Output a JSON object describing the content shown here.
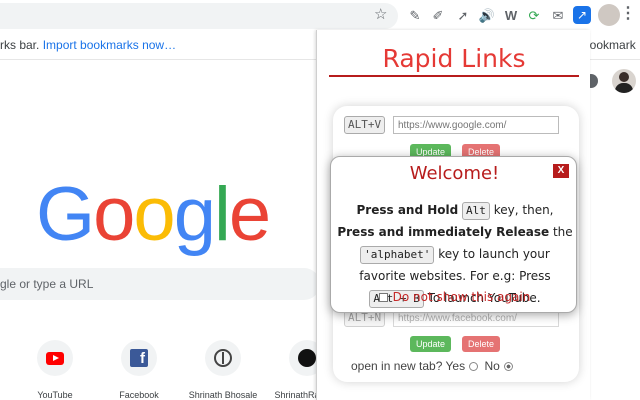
{
  "toolbar": {
    "icons": [
      "star-icon",
      "eyedropper-icon",
      "pen-icon",
      "arrow-icon",
      "speaker-icon",
      "w-icon",
      "refresh-icon",
      "mail-icon",
      "rapid-links-icon",
      "menu-icon"
    ],
    "accent": "#1a73e8"
  },
  "bookmarks_bar": {
    "left_text": "rks bar.",
    "import_link": "Import bookmarks now…",
    "right_text": "bookmark"
  },
  "google": {
    "logo_letters": [
      "G",
      "o",
      "o",
      "g",
      "l",
      "e"
    ],
    "logo_colors": [
      "#4285f4",
      "#ea4335",
      "#fbbc05",
      "#4285f4",
      "#34a853",
      "#ea4335"
    ],
    "search_placeholder": "gle or type a URL"
  },
  "shortcuts": [
    {
      "label": "YouTube",
      "icon": "youtube-icon"
    },
    {
      "label": "Facebook",
      "icon": "facebook-icon"
    },
    {
      "label": "Shrinath Bhosale",
      "icon": "brain-icon"
    },
    {
      "label": "ShrinathRaje (...",
      "icon": "github-icon"
    }
  ],
  "popup": {
    "title": "Rapid Links",
    "title_color": "#e53935",
    "entries": [
      {
        "shortcut": "ALT+V",
        "url_placeholder": "https://www.google.com/",
        "update_label": "Update",
        "delete_label": "Delete"
      },
      {
        "shortcut": "ALT+N",
        "url_placeholder": "https://www.facebook.com/",
        "update_label": "Update",
        "delete_label": "Delete"
      }
    ],
    "new_tab": {
      "question": "open in new tab?",
      "yes_label": "Yes",
      "no_label": "No",
      "selected": "No"
    }
  },
  "modal": {
    "title": "Welcome!",
    "close_label": "X",
    "body": {
      "p1": "Press and Hold",
      "k1": "Alt",
      "p2": "key, then,",
      "p3": "Press and immediately Release",
      "p4": "the",
      "k2": "'alphabet'",
      "p5": "key to launch your favorite websites. For e.g: Press",
      "k3": "Alt + B",
      "p6": "To launch YouTube."
    },
    "checkbox_label": "Do not show this again"
  }
}
